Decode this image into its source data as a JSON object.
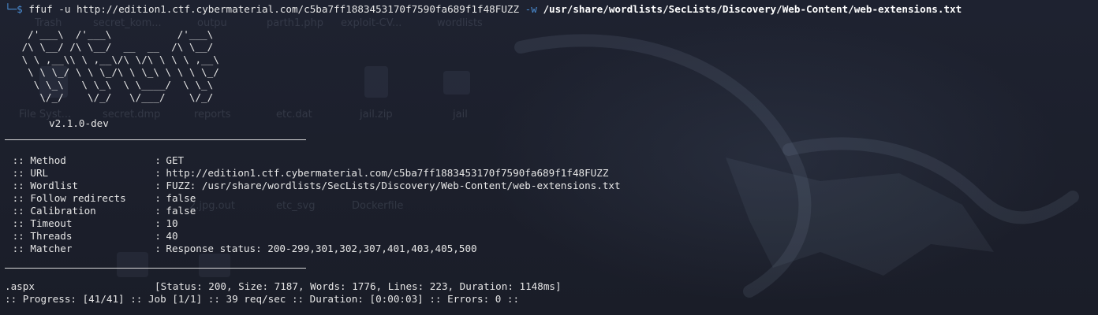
{
  "terminal": {
    "prompt_glyph": "└─$",
    "command": "ffuf -u http://edition1.ctf.cybermaterial.com/c5ba7ff1883453170f7590fa689f1f48FUZZ",
    "flag": "-w",
    "wordlist_arg": "/usr/share/wordlists/SecLists/Discovery/Web-Content/web-extensions.txt",
    "banner_art": "  /'___\\  /'___\\           /'___\\\n /\\ \\__/ /\\ \\__/  __  __  /\\ \\__/\n \\ \\ ,__\\\\ \\ ,__\\/\\ \\/\\ \\ \\ \\ ,__\\\n  \\ \\ \\_/ \\ \\ \\_/\\ \\ \\_\\ \\ \\ \\ \\_/\n   \\ \\_\\   \\ \\_\\  \\ \\____/  \\ \\_\\\n    \\/_/    \\/_/   \\/___/    \\/_/",
    "version": "v2.1.0-dev",
    "config_prefix": "::",
    "config_sep": ":",
    "config": [
      {
        "key": "Method",
        "value": "GET"
      },
      {
        "key": "URL",
        "value": "http://edition1.ctf.cybermaterial.com/c5ba7ff1883453170f7590fa689f1f48FUZZ"
      },
      {
        "key": "Wordlist",
        "value": "FUZZ: /usr/share/wordlists/SecLists/Discovery/Web-Content/web-extensions.txt"
      },
      {
        "key": "Follow redirects",
        "value": "false"
      },
      {
        "key": "Calibration",
        "value": "false"
      },
      {
        "key": "Timeout",
        "value": "10"
      },
      {
        "key": "Threads",
        "value": "40"
      },
      {
        "key": "Matcher",
        "value": "Response status: 200-299,301,302,307,401,403,405,500"
      }
    ],
    "result": {
      "path": ".aspx",
      "info": "[Status: 200, Size: 7187, Words: 1776, Lines: 223, Duration: 1148ms]"
    },
    "progress": ":: Progress: [41/41] :: Job [1/1] :: 39 req/sec :: Duration: [0:00:03] :: Errors: 0 ::"
  },
  "desktop": {
    "icons": [
      {
        "label": "Trash"
      },
      {
        "label": "secret_kom..."
      },
      {
        "label": "outpu"
      },
      {
        "label": "parth1.php"
      },
      {
        "label": "exploit-CV..."
      },
      {
        "label": "wordlists"
      },
      {
        "label": "File Syst..."
      },
      {
        "label": "secret.dmp"
      },
      {
        "label": "reports"
      },
      {
        "label": "etc.dat"
      },
      {
        "label": "jail.zip"
      },
      {
        "label": "jail"
      },
      {
        "label": "2.jpg.out"
      },
      {
        "label": "etc_svg"
      },
      {
        "label": "Dockerfile"
      }
    ]
  },
  "colors": {
    "background": "#1b1f2a",
    "text": "#e6e6e6",
    "prompt_accent": "#4b8fd6"
  }
}
